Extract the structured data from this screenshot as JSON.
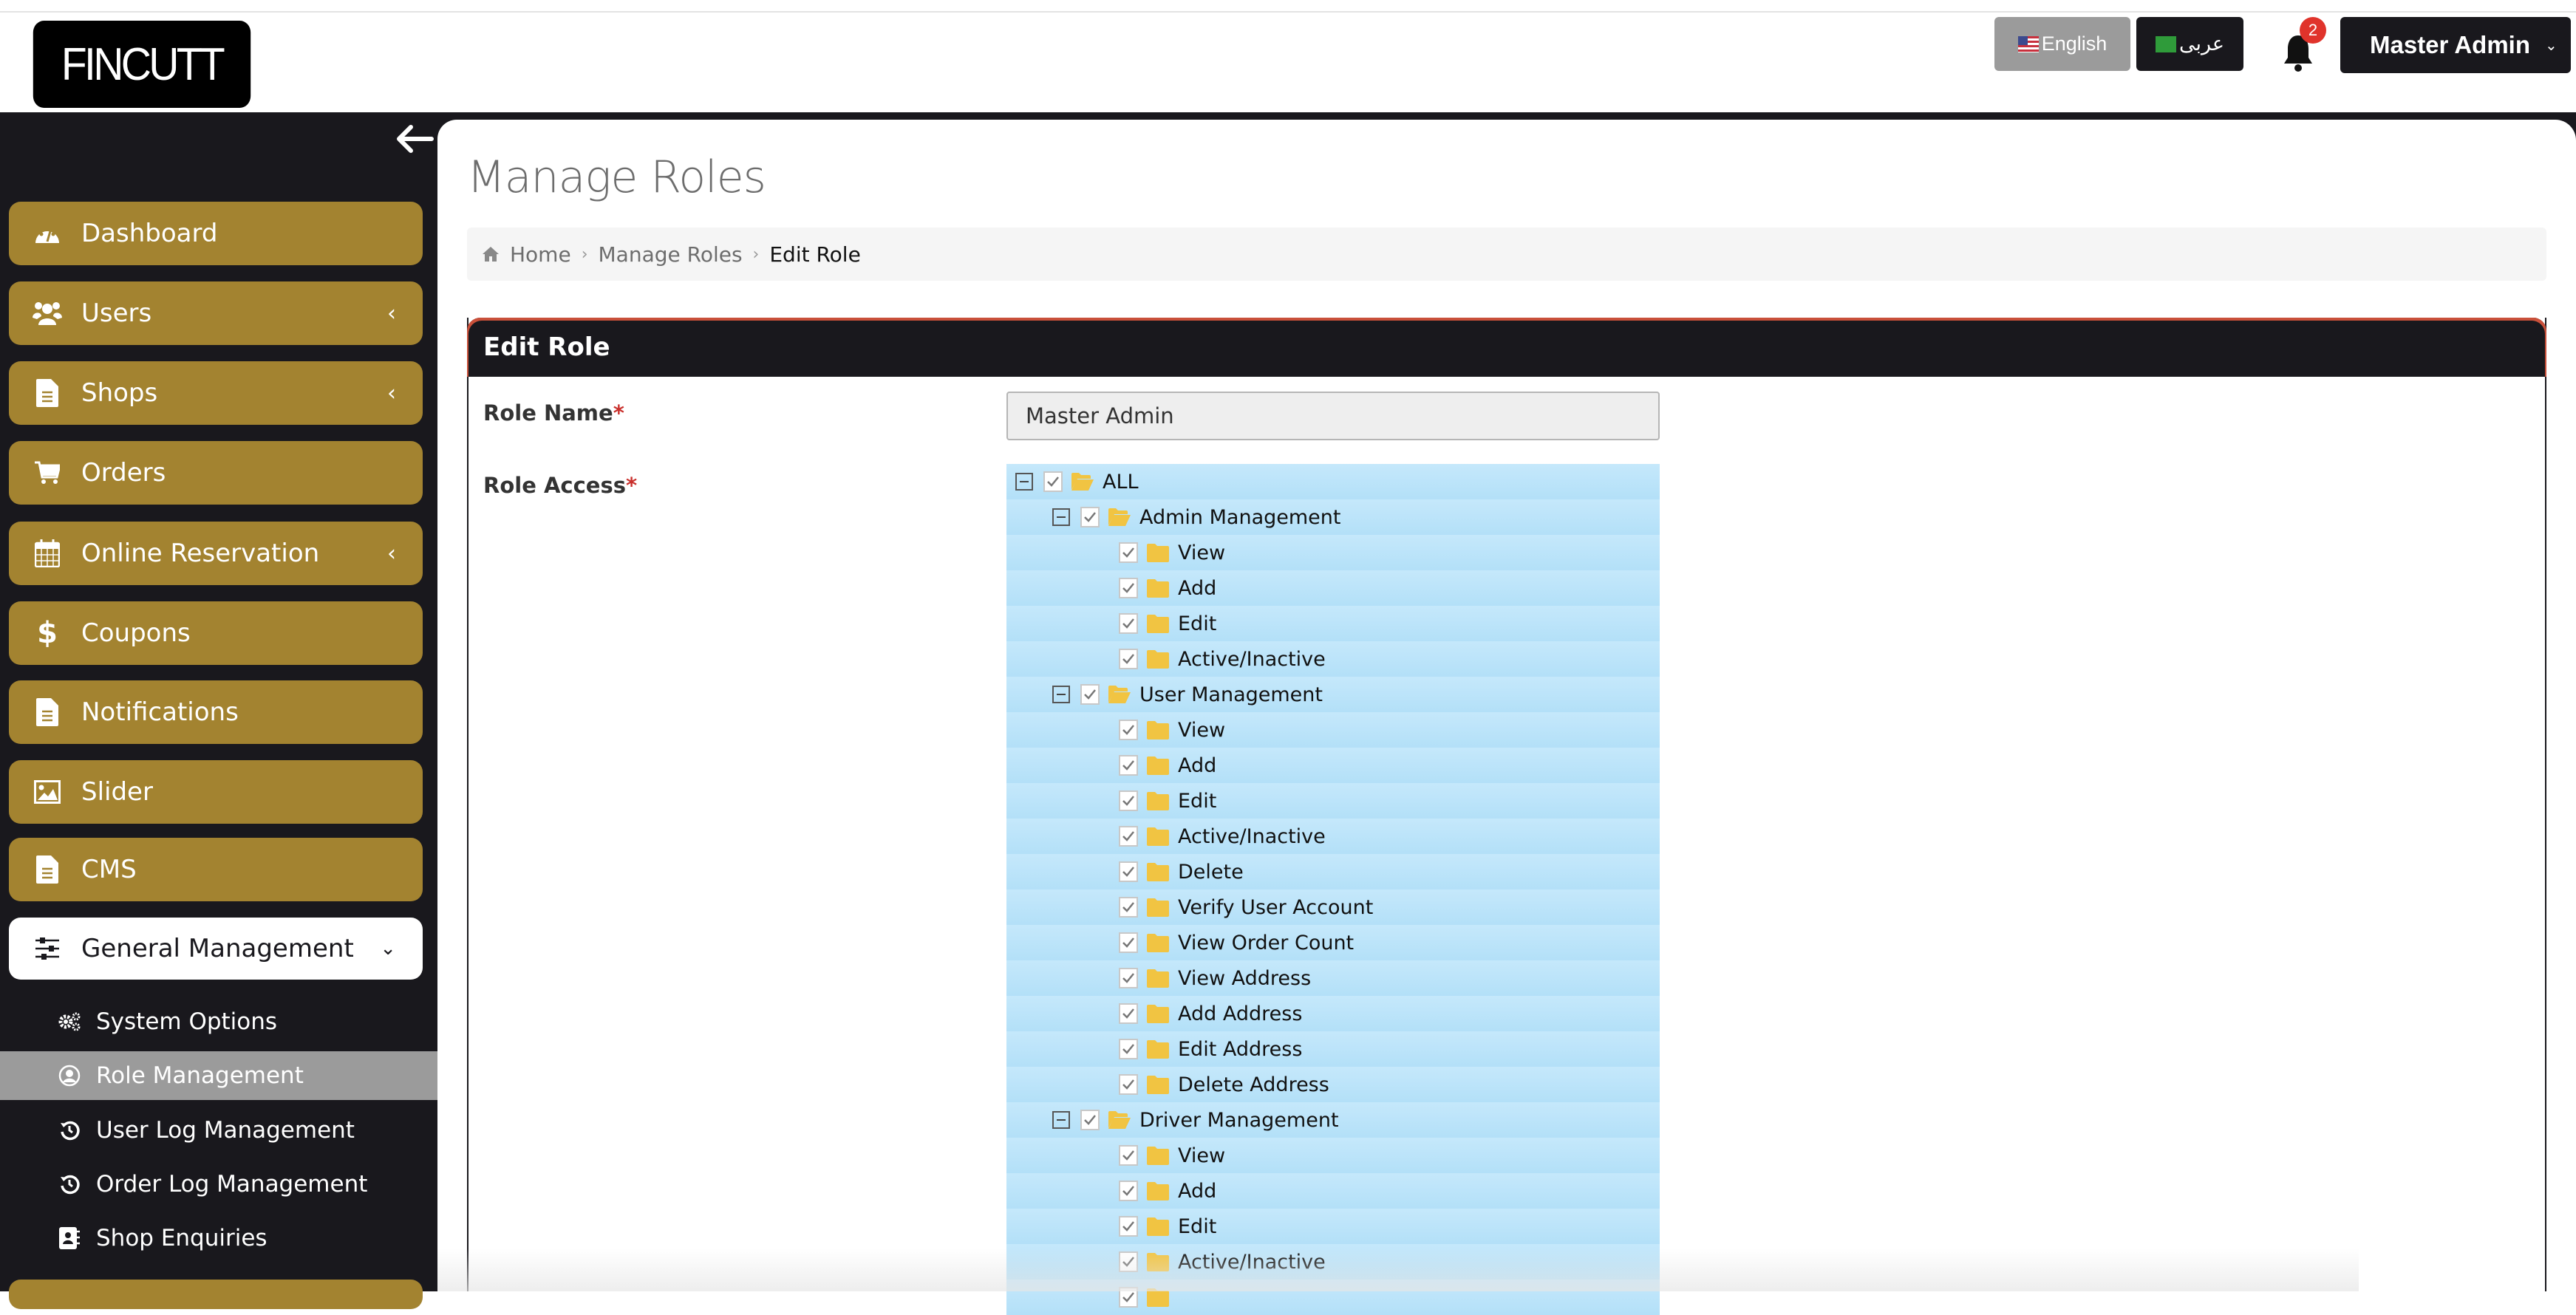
{
  "header": {
    "logo_text": "FINCUTT",
    "lang_english": "English",
    "lang_arabic": "عربى",
    "notification_count": "2",
    "user_menu_label": "Master Admin",
    "colors": {
      "brand_dark": "#19181d",
      "gold": "#a38330",
      "badge": "#e0332b"
    }
  },
  "sidebar": {
    "items": [
      {
        "label": "Dashboard",
        "icon": "dashboard-icon",
        "has_submenu": false
      },
      {
        "label": "Users",
        "icon": "users-icon",
        "has_submenu": true
      },
      {
        "label": "Shops",
        "icon": "file-icon",
        "has_submenu": true
      },
      {
        "label": "Orders",
        "icon": "cart-icon",
        "has_submenu": false
      },
      {
        "label": "Online Reservation",
        "icon": "calendar-icon",
        "has_submenu": true
      },
      {
        "label": "Coupons",
        "icon": "dollar-icon",
        "has_submenu": false
      },
      {
        "label": "Notifications",
        "icon": "file-icon",
        "has_submenu": false
      },
      {
        "label": "Slider",
        "icon": "image-icon",
        "has_submenu": false
      },
      {
        "label": "CMS",
        "icon": "file-icon",
        "has_submenu": false
      },
      {
        "label": "General Management",
        "icon": "sliders-icon",
        "has_submenu": true,
        "expanded": true
      }
    ],
    "subitems": [
      {
        "label": "System Options",
        "icon": "cogs-icon"
      },
      {
        "label": "Role Management",
        "icon": "user-circle-icon",
        "selected": true
      },
      {
        "label": "User Log Management",
        "icon": "history-icon"
      },
      {
        "label": "Order Log Management",
        "icon": "history-icon"
      },
      {
        "label": "Shop Enquiries",
        "icon": "address-book-icon"
      }
    ]
  },
  "main": {
    "page_title": "Manage Roles",
    "breadcrumb": [
      "Home",
      "Manage Roles",
      "Edit Role"
    ],
    "card_title": "Edit Role",
    "role_name_label": "Role Name",
    "role_access_label": "Role Access",
    "required_mark": "*",
    "role_name_value": "Master Admin",
    "tree": [
      {
        "label": "ALL",
        "level": 0,
        "checked": true,
        "expanded": true
      },
      {
        "label": "Admin Management",
        "level": 1,
        "checked": true,
        "expanded": true
      },
      {
        "label": "View",
        "level": 2,
        "checked": true
      },
      {
        "label": "Add",
        "level": 2,
        "checked": true
      },
      {
        "label": "Edit",
        "level": 2,
        "checked": true
      },
      {
        "label": "Active/Inactive",
        "level": 2,
        "checked": true
      },
      {
        "label": "User Management",
        "level": 1,
        "checked": true,
        "expanded": true
      },
      {
        "label": "View",
        "level": 2,
        "checked": true
      },
      {
        "label": "Add",
        "level": 2,
        "checked": true
      },
      {
        "label": "Edit",
        "level": 2,
        "checked": true
      },
      {
        "label": "Active/Inactive",
        "level": 2,
        "checked": true
      },
      {
        "label": "Delete",
        "level": 2,
        "checked": true
      },
      {
        "label": "Verify User Account",
        "level": 2,
        "checked": true
      },
      {
        "label": "View Order Count",
        "level": 2,
        "checked": true
      },
      {
        "label": "View Address",
        "level": 2,
        "checked": true
      },
      {
        "label": "Add Address",
        "level": 2,
        "checked": true
      },
      {
        "label": "Edit Address",
        "level": 2,
        "checked": true
      },
      {
        "label": "Delete Address",
        "level": 2,
        "checked": true
      },
      {
        "label": "Driver Management",
        "level": 1,
        "checked": true,
        "expanded": true
      },
      {
        "label": "View",
        "level": 2,
        "checked": true
      },
      {
        "label": "Add",
        "level": 2,
        "checked": true
      },
      {
        "label": "Edit",
        "level": 2,
        "checked": true
      },
      {
        "label": "Active/Inactive",
        "level": 2,
        "checked": true
      },
      {
        "label": "",
        "level": 2,
        "checked": true
      }
    ]
  }
}
